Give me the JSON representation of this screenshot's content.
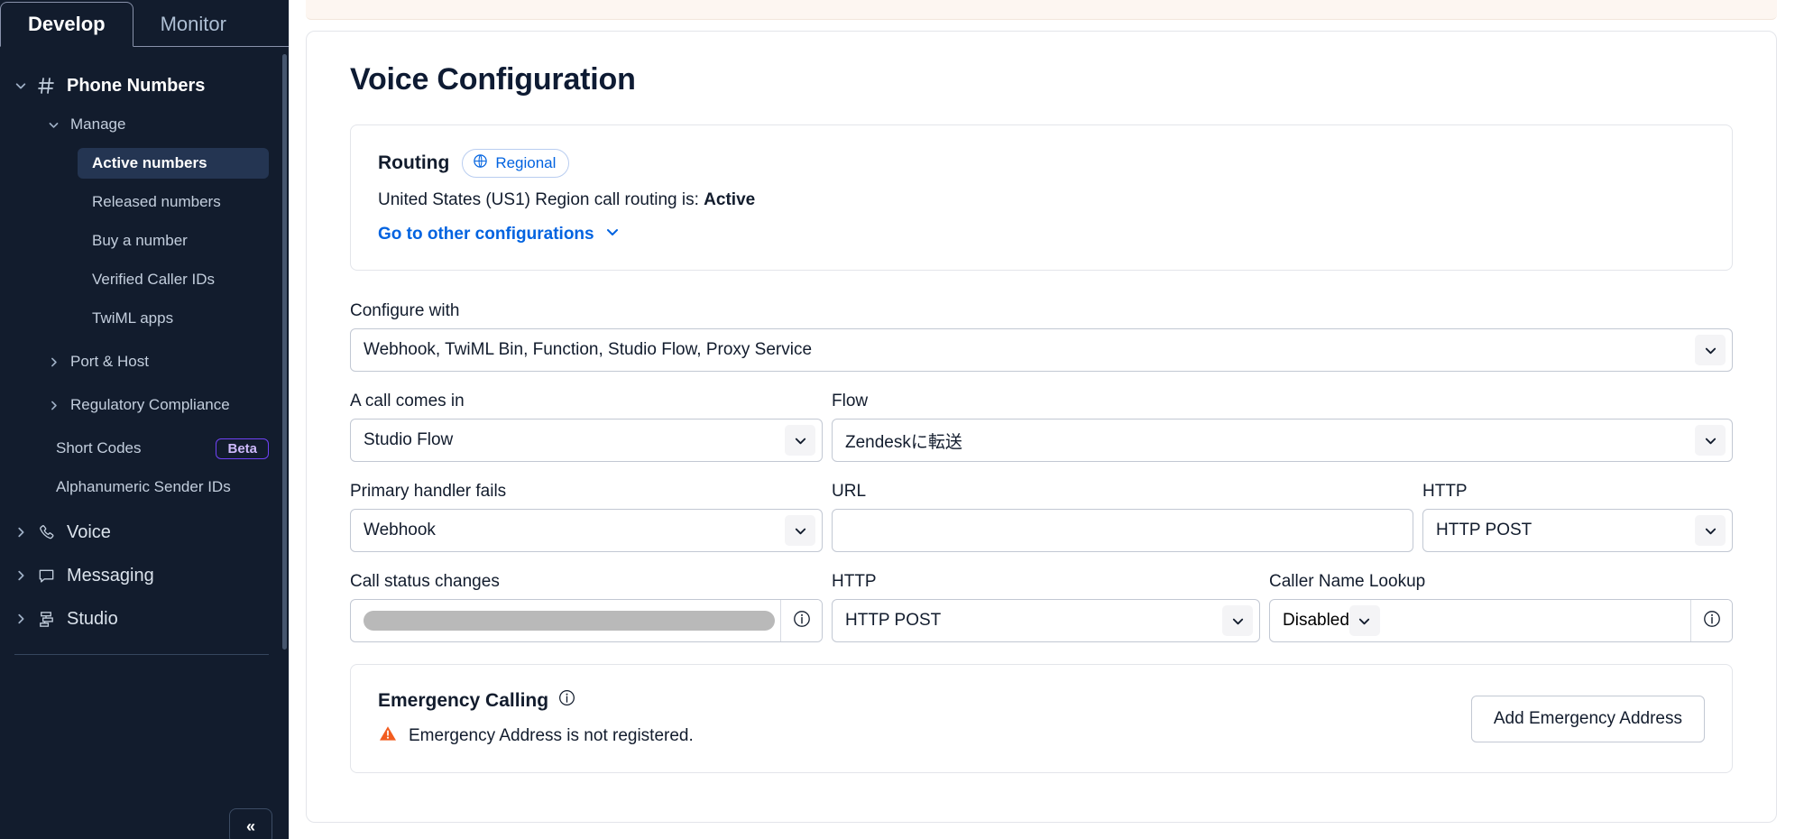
{
  "sidebar": {
    "tabs": [
      {
        "label": "Develop",
        "active": true
      },
      {
        "label": "Monitor",
        "active": false
      }
    ],
    "phone_numbers": {
      "label": "Phone Numbers",
      "icon": "hash-icon"
    },
    "manage": {
      "label": "Manage"
    },
    "manage_items": [
      {
        "label": "Active numbers",
        "selected": true
      },
      {
        "label": "Released numbers",
        "selected": false
      },
      {
        "label": "Buy a number",
        "selected": false
      },
      {
        "label": "Verified Caller IDs",
        "selected": false
      },
      {
        "label": "TwiML apps",
        "selected": false
      }
    ],
    "port_host": {
      "label": "Port & Host"
    },
    "regulatory": {
      "label": "Regulatory Compliance"
    },
    "short_codes": {
      "label": "Short Codes",
      "badge": "Beta"
    },
    "alphanumeric": {
      "label": "Alphanumeric Sender IDs"
    },
    "sections": [
      {
        "label": "Voice",
        "icon": "phone-icon"
      },
      {
        "label": "Messaging",
        "icon": "chat-bubble-icon"
      },
      {
        "label": "Studio",
        "icon": "studio-flow-icon"
      }
    ],
    "collapse_label": "«"
  },
  "main": {
    "page_title": "Voice Configuration",
    "routing": {
      "title": "Routing",
      "badge": "Regional",
      "badge_icon": "globe-icon",
      "status_prefix": "United States (US1) Region call routing is: ",
      "status_value": "Active",
      "link": "Go to other configurations",
      "link_icon": "chevron-down-icon"
    },
    "configure_with": {
      "label": "Configure with",
      "value": "Webhook, TwiML Bin, Function, Studio Flow, Proxy Service"
    },
    "call_comes_in": {
      "label": "A call comes in",
      "value": "Studio Flow"
    },
    "flow": {
      "label": "Flow",
      "value": "Zendeskに転送"
    },
    "primary_handler_fails": {
      "label": "Primary handler fails",
      "value": "Webhook"
    },
    "fallback_url": {
      "label": "URL",
      "value": "",
      "placeholder": ""
    },
    "fallback_http": {
      "label": "HTTP",
      "value": "HTTP POST"
    },
    "call_status_changes": {
      "label": "Call status changes",
      "value": "",
      "redacted": true,
      "info_icon": "info-icon"
    },
    "status_http": {
      "label": "HTTP",
      "value": "HTTP POST"
    },
    "caller_name_lookup": {
      "label": "Caller Name Lookup",
      "value": "Disabled",
      "info_icon": "info-icon"
    },
    "emergency": {
      "title": "Emergency Calling",
      "info_icon": "info-icon",
      "warning_icon": "warning-triangle-icon",
      "message": "Emergency Address is not registered.",
      "button": "Add Emergency Address"
    }
  },
  "colors": {
    "sidebar_bg": "#121c2d",
    "link_blue": "#0263e0",
    "beta_purple": "#6f42f5",
    "warning_orange": "#f25c1f"
  }
}
